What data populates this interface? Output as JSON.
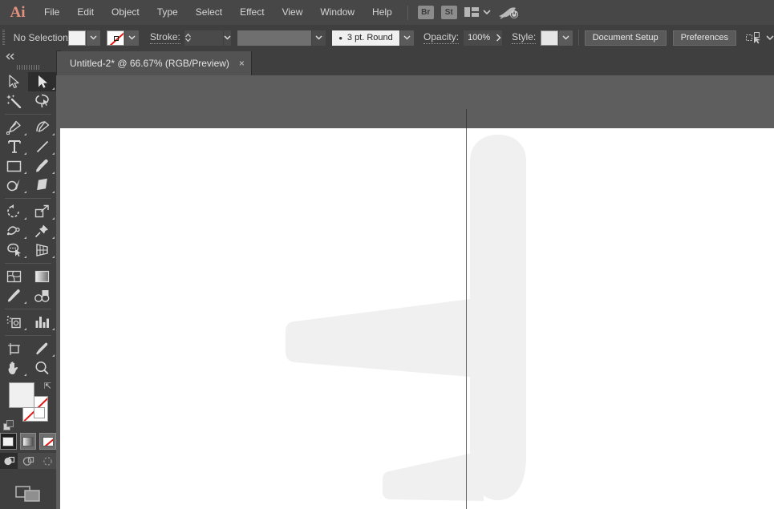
{
  "app": {
    "name": "Adobe Illustrator",
    "logo": "Ai"
  },
  "menubar": {
    "items": [
      {
        "label": "File"
      },
      {
        "label": "Edit"
      },
      {
        "label": "Object"
      },
      {
        "label": "Type"
      },
      {
        "label": "Select"
      },
      {
        "label": "Effect"
      },
      {
        "label": "View"
      },
      {
        "label": "Window"
      },
      {
        "label": "Help"
      }
    ],
    "bridge_label": "Br",
    "stock_label": "St",
    "workspace_icon": "workspace-switcher-icon",
    "search_icon": "rocket-icon"
  },
  "controlbar": {
    "selection_status": "No Selection",
    "fill_swatch_color": "#f2f2f2",
    "stroke_swatch": "none",
    "stroke_label": "Stroke:",
    "stroke_weight_value": "",
    "brush_definition_value": "",
    "profile_value": "3 pt. Round",
    "opacity_label": "Opacity:",
    "opacity_value": "100%",
    "style_label": "Style:",
    "document_setup_label": "Document Setup",
    "preferences_label": "Preferences"
  },
  "tabbar": {
    "tabs": [
      {
        "title": "Untitled-2* @ 66.67% (RGB/Preview)",
        "close": "×",
        "active": true
      }
    ]
  },
  "toolbar": {
    "collapse_label": "«",
    "tools": [
      {
        "name": "selection-tool",
        "active": false,
        "has_flyout": false
      },
      {
        "name": "direct-selection-tool",
        "active": true,
        "has_flyout": true
      },
      {
        "name": "magic-wand-tool",
        "active": false,
        "has_flyout": false
      },
      {
        "name": "lasso-tool",
        "active": false,
        "has_flyout": false
      },
      {
        "name": "pen-tool",
        "active": false,
        "has_flyout": true
      },
      {
        "name": "curvature-tool",
        "active": false,
        "has_flyout": true
      },
      {
        "name": "type-tool",
        "active": false,
        "has_flyout": true
      },
      {
        "name": "line-segment-tool",
        "active": false,
        "has_flyout": true
      },
      {
        "name": "rectangle-tool",
        "active": false,
        "has_flyout": true
      },
      {
        "name": "paintbrush-tool",
        "active": false,
        "has_flyout": true
      },
      {
        "name": "shaper-tool",
        "active": false,
        "has_flyout": true
      },
      {
        "name": "eraser-tool",
        "active": false,
        "has_flyout": true
      },
      {
        "name": "rotate-tool",
        "active": false,
        "has_flyout": true
      },
      {
        "name": "scale-tool",
        "active": false,
        "has_flyout": true
      },
      {
        "name": "width-tool",
        "active": false,
        "has_flyout": true
      },
      {
        "name": "free-transform-tool",
        "active": false,
        "has_flyout": true
      },
      {
        "name": "shape-builder-tool",
        "active": false,
        "has_flyout": true
      },
      {
        "name": "perspective-grid-tool",
        "active": false,
        "has_flyout": true
      },
      {
        "name": "mesh-tool",
        "active": false,
        "has_flyout": false
      },
      {
        "name": "gradient-tool",
        "active": false,
        "has_flyout": false
      },
      {
        "name": "eyedropper-tool",
        "active": false,
        "has_flyout": true
      },
      {
        "name": "blend-tool",
        "active": false,
        "has_flyout": false
      },
      {
        "name": "symbol-sprayer-tool",
        "active": false,
        "has_flyout": true
      },
      {
        "name": "column-graph-tool",
        "active": false,
        "has_flyout": true
      },
      {
        "name": "artboard-tool",
        "active": false,
        "has_flyout": false
      },
      {
        "name": "slice-tool",
        "active": false,
        "has_flyout": true
      },
      {
        "name": "hand-tool",
        "active": false,
        "has_flyout": true
      },
      {
        "name": "zoom-tool",
        "active": false,
        "has_flyout": false
      }
    ],
    "fill_color": "#f0f0f0",
    "stroke_color": "none",
    "color_modes": [
      "color-mode",
      "gradient-mode",
      "none-mode"
    ],
    "color_mode_selected": 0,
    "draw_modes": [
      "draw-normal",
      "draw-behind",
      "draw-inside"
    ],
    "draw_mode_selected": 0,
    "screen_mode": "change-screen-mode"
  },
  "canvas": {
    "artwork_name": "airplane-silhouette",
    "artwork_color": "#f0f0f0",
    "background_color": "#5e5e5e",
    "artboard_color": "#ffffff",
    "guide_color": "#6a6a6a"
  }
}
